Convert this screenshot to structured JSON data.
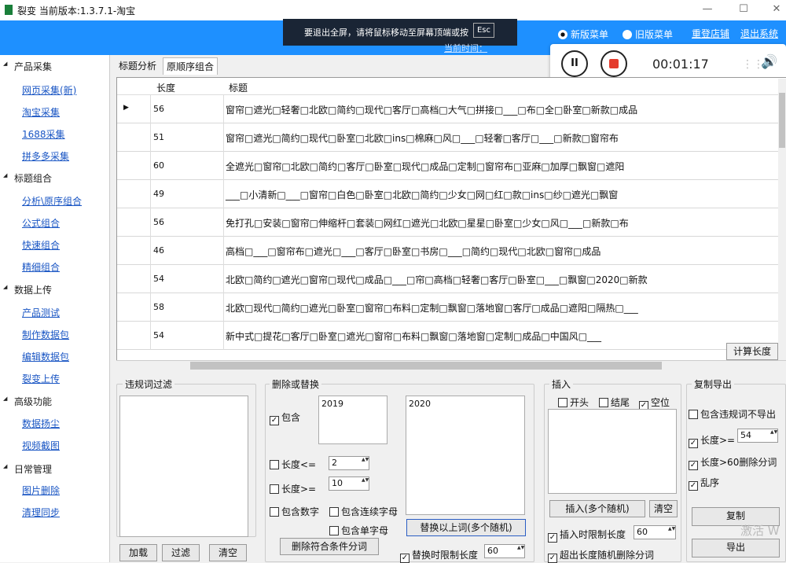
{
  "window": {
    "title": "裂变  当前版本:1.3.7.1-淘宝",
    "min": "—",
    "max": "☐",
    "close": "✕"
  },
  "banner": {
    "text": "要退出全屏，请将鼠标移动至屏幕顶端或按",
    "esc": "Esc"
  },
  "subtext": "当前时间：",
  "menu": {
    "new_menu": "新版菜单",
    "old_menu": "旧版菜单",
    "relogin": "重登店铺",
    "logout": "退出系统"
  },
  "recorder": {
    "pause": "II",
    "time": "00:01:17",
    "separator": "⋮⋮",
    "volume_icon": "🔊"
  },
  "sidebar": {
    "groups": [
      {
        "label": "产品采集",
        "items": [
          "网页采集(新)",
          "淘宝采集",
          "1688采集",
          "拼多多采集"
        ]
      },
      {
        "label": "标题组合",
        "items": [
          "分析\\原序组合",
          "公式组合",
          "快速组合",
          "精细组合"
        ]
      },
      {
        "label": "数据上传",
        "items": [
          "产品测试",
          "制作数据包",
          "编辑数据包",
          "裂变上传"
        ]
      },
      {
        "label": "高级功能",
        "items": [
          "数据扬尘",
          "视频截图"
        ]
      },
      {
        "label": "日常管理",
        "items": [
          "图片删除",
          "清理同步"
        ]
      }
    ]
  },
  "tabs": [
    "标题分析",
    "原顺序组合"
  ],
  "grid": {
    "headers": [
      "长度",
      "标题"
    ],
    "rows": [
      {
        "len": "56",
        "title": "窗帘□遮光□轻奢□北欧□简约□现代□客厅□高档□大气□拼接□___□布□全□卧室□新款□成品"
      },
      {
        "len": "51",
        "title": "窗帘□遮光□简约□现代□卧室□北欧□ins□棉麻□风□___□轻奢□客厅□___□新款□窗帘布"
      },
      {
        "len": "60",
        "title": "全遮光□窗帘□北欧□简约□客厅□卧室□现代□成品□定制□窗帘布□亚麻□加厚□飘窗□遮阳"
      },
      {
        "len": "49",
        "title": "___□小清新□___□窗帘□白色□卧室□北欧□简约□少女□网□红□款□ins□纱□遮光□飘窗"
      },
      {
        "len": "56",
        "title": "免打孔□安装□窗帘□伸缩杆□套装□网红□遮光□北欧□星星□卧室□少女□风□___□新款□布"
      },
      {
        "len": "46",
        "title": "高档□___□窗帘布□遮光□___□客厅□卧室□书房□___□简约□现代□北欧□窗帘□成品"
      },
      {
        "len": "54",
        "title": "北欧□简约□遮光□窗帘□现代□成品□___□帘□高档□轻奢□客厅□卧室□___□飘窗□2020□新款"
      },
      {
        "len": "58",
        "title": "北欧□现代□简约□遮光□卧室□窗帘□布料□定制□飘窗□落地窗□客厅□成品□遮阳□隔热□___"
      },
      {
        "len": "54",
        "title": "新中式□提花□客厅□卧室□遮光□窗帘□布料□飘窗□落地窗□定制□成品□中国风□___"
      }
    ],
    "calc_button": "计算长度"
  },
  "filter": {
    "label": "违规词过滤",
    "add": "加载",
    "filter": "过滤",
    "clear": "清空"
  },
  "replace": {
    "label": "删除或替换",
    "contains": "包含",
    "contains_value": "2019",
    "replace_value": "2020",
    "len_le": "长度<=",
    "len_le_value": "2",
    "len_ge": "长度>=",
    "len_ge_value": "10",
    "has_digit": "包含数字",
    "has_cont_letter": "包含连续字母",
    "has_single_letter": "包含单字母",
    "delete_btn": "删除符合条件分词",
    "replace_btn": "替换以上词(多个随机)",
    "limit_chk": "替换时限制长度",
    "limit_value": "60"
  },
  "insert": {
    "label": "插入",
    "head": "开头",
    "tail": "结尾",
    "space": "空位",
    "insert_btn": "插入(多个随机)",
    "clear": "清空",
    "limit_chk": "插入时限制长度",
    "limit_value": "60",
    "over_chk": "超出长度随机删除分词"
  },
  "export": {
    "label": "复制导出",
    "no_bad": "包含违规词不导出",
    "len_ge": "长度>=",
    "len_ge_value": "54",
    "del_over": "长度>60删除分词",
    "shuffle": "乱序",
    "copy": "复制",
    "export": "导出"
  },
  "watermark": "激活 W"
}
